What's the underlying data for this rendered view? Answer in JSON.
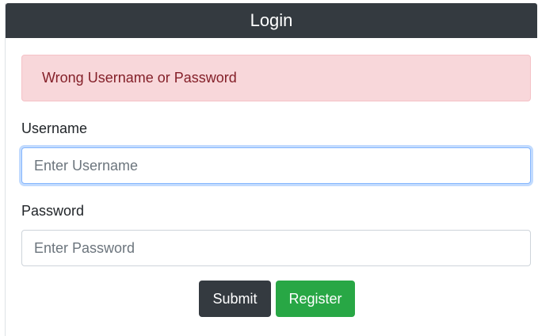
{
  "header": {
    "title": "Login"
  },
  "alert": {
    "message": "Wrong Username or Password"
  },
  "form": {
    "username": {
      "label": "Username",
      "placeholder": "Enter Username",
      "value": ""
    },
    "password": {
      "label": "Password",
      "placeholder": "Enter Password",
      "value": ""
    }
  },
  "buttons": {
    "submit": "Submit",
    "register": "Register"
  },
  "colors": {
    "header_bg": "#343a40",
    "alert_bg": "#f8d7da",
    "alert_text": "#842029",
    "submit_bg": "#343a40",
    "register_bg": "#28a745",
    "focus_border": "#86b7fe"
  }
}
